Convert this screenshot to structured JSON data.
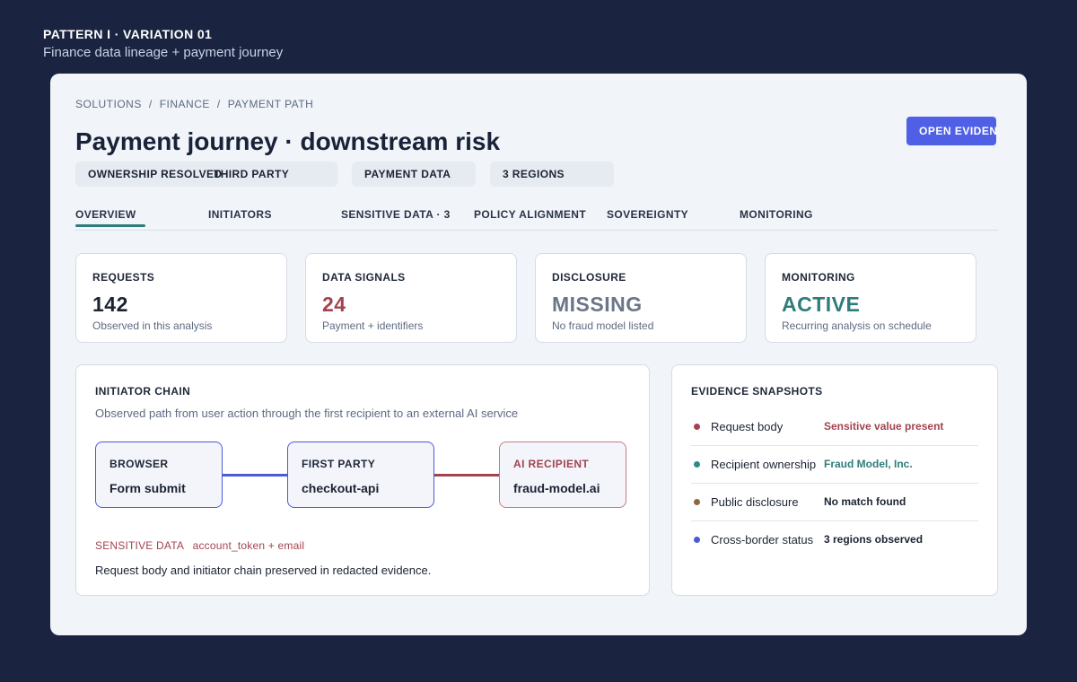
{
  "header": {
    "pattern": "PATTERN I · VARIATION 01",
    "subtitle": "Finance data lineage + payment journey"
  },
  "breadcrumb": [
    "SOLUTIONS",
    "FINANCE",
    "PAYMENT PATH"
  ],
  "page_title": "Payment journey · downstream risk",
  "open_button": "OPEN EVIDENCE",
  "chips": {
    "ownership": "OWNERSHIP RESOLVED",
    "third_party": "THIRD PARTY",
    "payment_data": "PAYMENT DATA",
    "regions": "3 REGIONS"
  },
  "tabs": [
    "OVERVIEW",
    "INITIATORS",
    "SENSITIVE DATA · 3",
    "POLICY ALIGNMENT",
    "SOVEREIGNTY",
    "MONITORING"
  ],
  "stats": [
    {
      "label": "REQUESTS",
      "value": "142",
      "desc": "Observed in this analysis",
      "color": "#1c2333"
    },
    {
      "label": "DATA SIGNALS",
      "value": "24",
      "desc": "Payment + identifiers",
      "color": "#a3434f"
    },
    {
      "label": "DISCLOSURE",
      "value": "MISSING",
      "desc": "No fraud model listed",
      "color": "#6b7689"
    },
    {
      "label": "MONITORING",
      "value": "ACTIVE",
      "desc": "Recurring analysis on schedule",
      "color": "#2e7d7a"
    }
  ],
  "chain": {
    "title": "INITIATOR CHAIN",
    "subtitle": "Observed path from user action through the first recipient to an external AI service",
    "nodes": [
      {
        "label": "BROWSER",
        "value": "Form submit"
      },
      {
        "label": "FIRST PARTY",
        "value": "checkout-api"
      },
      {
        "label": "AI RECIPIENT",
        "value": "fraud-model.ai"
      }
    ],
    "sensitive_tag": "SENSITIVE DATA",
    "sensitive_value": "account_token + email",
    "note": "Request body and initiator chain preserved in redacted evidence."
  },
  "evidence": {
    "title": "EVIDENCE SNAPSHOTS",
    "rows": [
      {
        "key": "Request body",
        "value": "Sensitive value present",
        "dot": "#a3434f",
        "color": "#a3434f"
      },
      {
        "key": "Recipient ownership",
        "value": "Fraud Model, Inc.",
        "dot": "#2e8a8a",
        "color": "#2e7d7a"
      },
      {
        "key": "Public disclosure",
        "value": "No match found",
        "dot": "#8a6a3a",
        "color": "#1c2333"
      },
      {
        "key": "Cross-border status",
        "value": "3 regions observed",
        "dot": "#4a5ad8",
        "color": "#1c2333"
      }
    ]
  },
  "colors": {
    "accent": "#5060e6",
    "teal": "#2e7d7a",
    "risk": "#a3434f",
    "background": "#1a2340"
  }
}
